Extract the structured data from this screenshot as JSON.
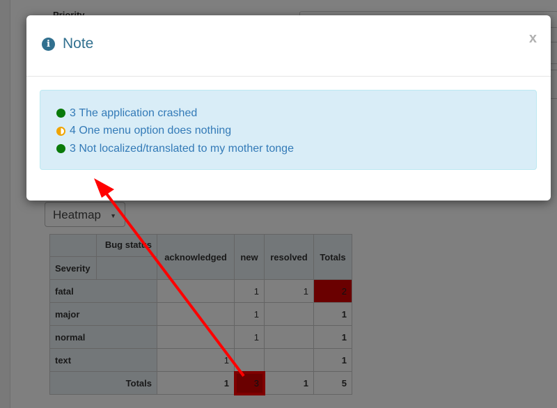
{
  "background": {
    "top_label": "Priority",
    "renderer": {
      "selected": "Heatmap"
    },
    "pivot": {
      "col_attr": "Bug status",
      "row_attr": "Severity",
      "columns": [
        "acknowledged",
        "new",
        "resolved"
      ],
      "totals_label": "Totals",
      "rows": [
        {
          "label": "fatal",
          "acknowledged": "",
          "new": "1",
          "resolved": "1",
          "total": "2"
        },
        {
          "label": "major",
          "acknowledged": "",
          "new": "1",
          "resolved": "",
          "total": "1"
        },
        {
          "label": "normal",
          "acknowledged": "",
          "new": "1",
          "resolved": "",
          "total": "1"
        },
        {
          "label": "text",
          "acknowledged": "1",
          "new": "",
          "resolved": "",
          "total": "1"
        }
      ],
      "col_totals": {
        "acknowledged": "1",
        "new": "3",
        "resolved": "1",
        "grand": "5"
      }
    }
  },
  "modal": {
    "title": "Note",
    "close_label": "x",
    "items": [
      {
        "count": "3",
        "text": "The application crashed",
        "status": "green"
      },
      {
        "count": "4",
        "text": "One menu option does nothing",
        "status": "half"
      },
      {
        "count": "3",
        "text": "Not localized/translated to my mother tonge",
        "status": "green"
      }
    ]
  },
  "colors": {
    "info": "#31708f",
    "link": "#337ab7",
    "alert_bg": "#d9edf7",
    "heat": "#d40000",
    "annotation": "#ff0000"
  }
}
